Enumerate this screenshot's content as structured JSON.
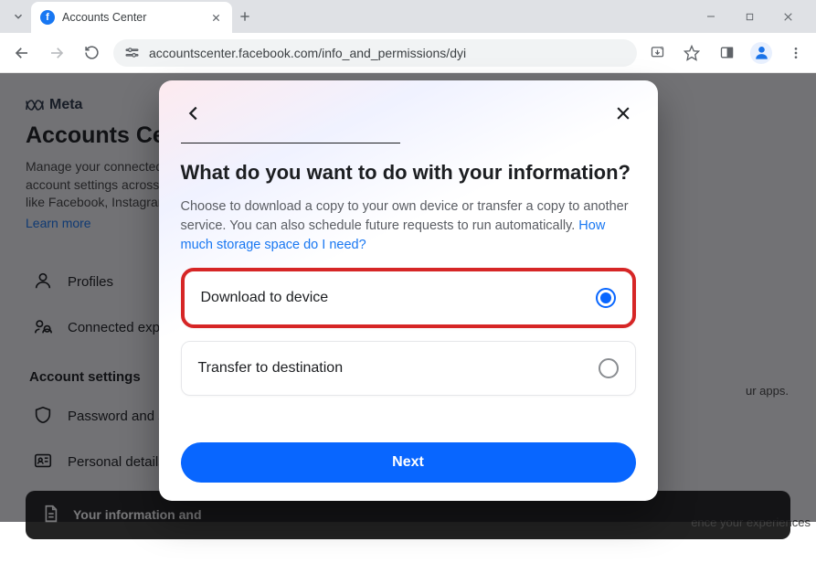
{
  "browser": {
    "tab_title": "Accounts Center",
    "url": "accountscenter.facebook.com/info_and_permissions/dyi"
  },
  "page": {
    "brand": "Meta",
    "title": "Accounts Center",
    "desc_visible": "Manage your connected ex\naccount settings across Me\nlike Facebook, Instagram a",
    "learn_more": "Learn more",
    "sidebar": {
      "items": [
        {
          "label": "Profiles"
        },
        {
          "label": "Connected experi"
        }
      ],
      "section_header": "Account settings",
      "settings": [
        {
          "label": "Password and sec"
        },
        {
          "label": "Personal details"
        }
      ],
      "card_label": "Your information and"
    },
    "snippet_right": "ence your experiences",
    "snippet_right2": "ur apps."
  },
  "modal": {
    "title": "What do you want to do with your information?",
    "desc": "Choose to download a copy to your own device or transfer a copy to another service. You can also schedule future requests to run automatically. ",
    "link": "How much storage space do I need?",
    "options": [
      {
        "label": "Download to device",
        "selected": true
      },
      {
        "label": "Transfer to destination",
        "selected": false
      }
    ],
    "next": "Next"
  }
}
